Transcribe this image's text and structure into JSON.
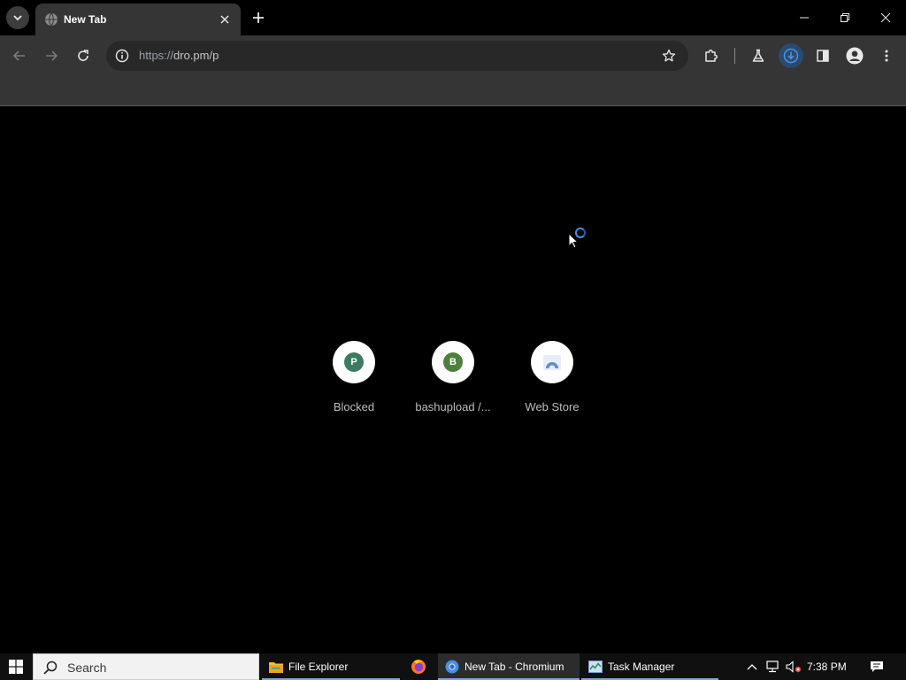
{
  "browser": {
    "tab": {
      "title": "New Tab"
    },
    "omnibox": {
      "url_scheme": "https://",
      "url_rest": "dro.pm/p"
    }
  },
  "shortcuts": [
    {
      "letter": "P",
      "label": "Blocked",
      "color": "#3d7a63"
    },
    {
      "letter": "B",
      "label": "bashupload /...",
      "color": "#4e7f3d"
    },
    {
      "letter": "",
      "label": "Web Store",
      "color": "#ffffff"
    }
  ],
  "taskbar": {
    "search_placeholder": "Search",
    "apps": [
      {
        "label": "File Explorer"
      },
      {
        "label": ""
      },
      {
        "label": "New Tab - Chromium"
      },
      {
        "label": "Task Manager"
      }
    ],
    "clock": "7:38 PM"
  },
  "colors": {
    "accent_blue": "#4a90e2",
    "toolbar_bg": "#353535",
    "tabstrip_bg": "#000000"
  }
}
